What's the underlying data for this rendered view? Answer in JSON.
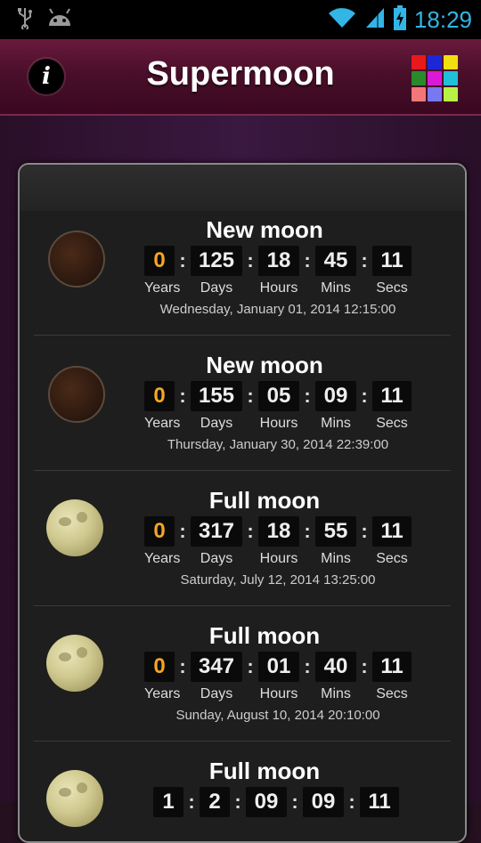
{
  "status_bar": {
    "time": "18:29",
    "icons": [
      "usb-icon",
      "android-icon",
      "wifi-icon",
      "signal-icon",
      "battery-charging-icon"
    ]
  },
  "action_bar": {
    "title": "Supermoon",
    "info_label": "i",
    "grid_colors": [
      "#e8191a",
      "#1d27d6",
      "#f0e010",
      "#2a8a2a",
      "#d81ad8",
      "#20c0d8",
      "#f07878",
      "#7878f0",
      "#b8f048"
    ]
  },
  "events": [
    {
      "title": "New moon",
      "phase": "new",
      "years": "0",
      "days": "125",
      "hours": "18",
      "mins": "45",
      "secs": "11",
      "datetime": "Wednesday, January 01, 2014  12:15:00"
    },
    {
      "title": "New moon",
      "phase": "new",
      "years": "0",
      "days": "155",
      "hours": "05",
      "mins": "09",
      "secs": "11",
      "datetime": "Thursday, January 30, 2014  22:39:00"
    },
    {
      "title": "Full moon",
      "phase": "full",
      "years": "0",
      "days": "317",
      "hours": "18",
      "mins": "55",
      "secs": "11",
      "datetime": "Saturday, July 12, 2014  13:25:00"
    },
    {
      "title": "Full moon",
      "phase": "full",
      "years": "0",
      "days": "347",
      "hours": "01",
      "mins": "40",
      "secs": "11",
      "datetime": "Sunday, August 10, 2014  20:10:00"
    },
    {
      "title": "Full moon",
      "phase": "full",
      "years": "1",
      "days": "2",
      "hours": "09",
      "mins": "09",
      "secs": "11",
      "datetime": ""
    }
  ],
  "units": {
    "years": "Years",
    "days": "Days",
    "hours": "Hours",
    "mins": "Mins",
    "secs": "Secs"
  },
  "colors": {
    "accent_orange": "#f5a623",
    "status_time": "#33b5e5",
    "action_bar": "#4a0f2a"
  }
}
